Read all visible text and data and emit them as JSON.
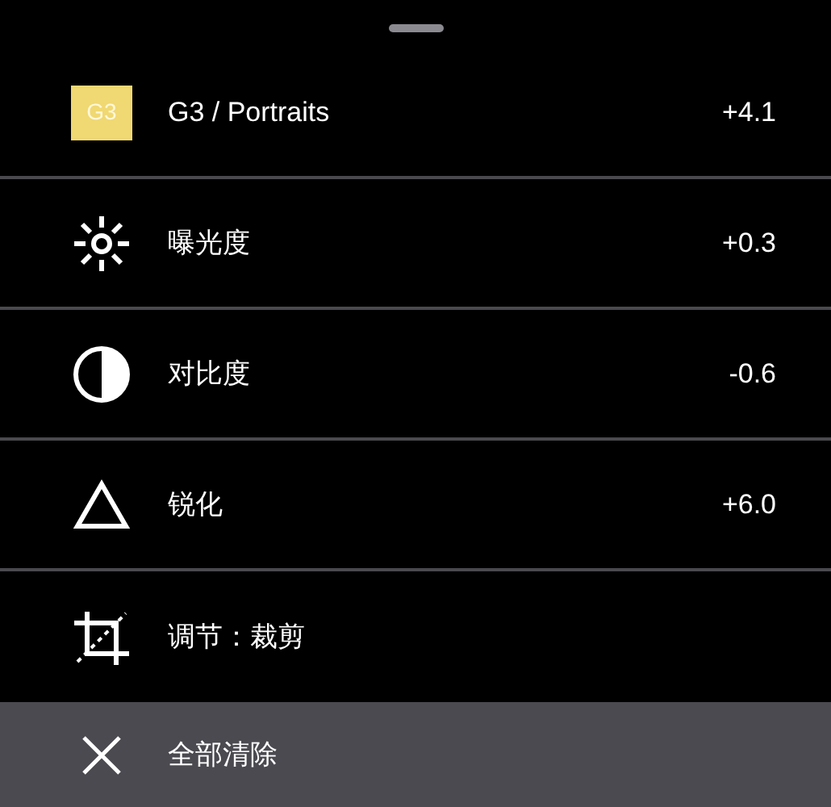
{
  "items": [
    {
      "kind": "filter",
      "badge": "G3",
      "label": "G3 / Portraits",
      "value": "+4.1"
    },
    {
      "kind": "exposure",
      "label": "曝光度",
      "value": "+0.3"
    },
    {
      "kind": "contrast",
      "label": "对比度",
      "value": "-0.6"
    },
    {
      "kind": "sharpen",
      "label": "锐化",
      "value": "+6.0"
    },
    {
      "kind": "crop",
      "label": "调节：裁剪"
    }
  ],
  "clear_all": {
    "label": "全部清除"
  }
}
